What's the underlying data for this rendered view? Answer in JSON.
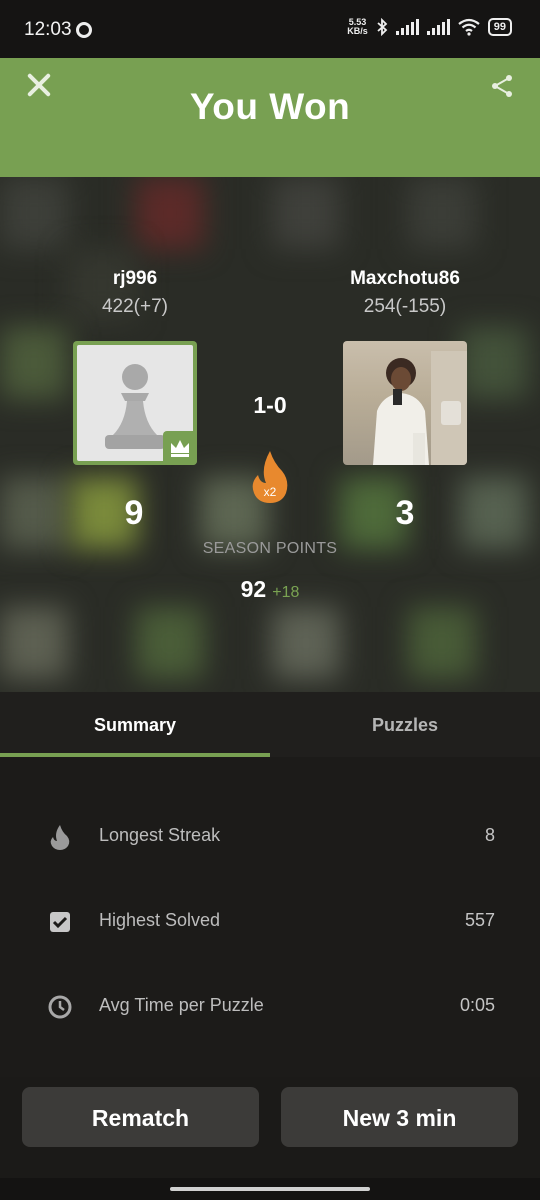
{
  "status": {
    "time": "12:03",
    "speed_top": "5.53",
    "speed_bottom": "KB/s",
    "battery": "99"
  },
  "header": {
    "title": "You Won",
    "close_icon": "close-icon",
    "share_icon": "share-icon",
    "color": "#78a052"
  },
  "player1": {
    "name": "rj996",
    "rating": "422(+7)",
    "points": "9",
    "avatar": "pawn-avatar",
    "badge": "crown-icon"
  },
  "player2": {
    "name": "Maxchotu86",
    "rating": "254(-155)",
    "points": "3",
    "avatar": "photo-avatar"
  },
  "result": {
    "score": "1-0",
    "multiplier": "x2"
  },
  "season": {
    "label": "SEASON POINTS",
    "value": "92",
    "delta": "+18"
  },
  "tabs": {
    "summary": "Summary",
    "puzzles": "Puzzles",
    "active": "Summary"
  },
  "stats": [
    {
      "icon": "flame-icon",
      "label": "Longest Streak",
      "value": "8"
    },
    {
      "icon": "checkbox-icon",
      "label": "Highest Solved",
      "value": "557"
    },
    {
      "icon": "clock-icon",
      "label": "Avg Time per Puzzle",
      "value": "0:05"
    }
  ],
  "buttons": {
    "rematch": "Rematch",
    "new_game": "New 3 min"
  }
}
